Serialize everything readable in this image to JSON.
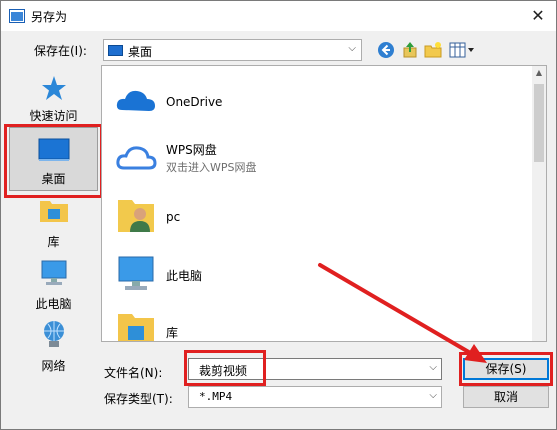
{
  "window": {
    "title": "另存为",
    "close_glyph": "✕"
  },
  "location": {
    "label": "保存在(I):",
    "value": "桌面"
  },
  "places": [
    {
      "label": "快速访问",
      "icon": "star-icon"
    },
    {
      "label": "桌面",
      "icon": "desktop-icon"
    },
    {
      "label": "库",
      "icon": "library-icon"
    },
    {
      "label": "此电脑",
      "icon": "computer-icon"
    },
    {
      "label": "网络",
      "icon": "network-icon"
    }
  ],
  "items": [
    {
      "name": "OneDrive",
      "sub": "",
      "icon": "onedrive-icon"
    },
    {
      "name": "WPS网盘",
      "sub": "双击进入WPS网盘",
      "icon": "wps-cloud-icon"
    },
    {
      "name": "pc",
      "sub": "",
      "icon": "user-folder-icon"
    },
    {
      "name": "此电脑",
      "sub": "",
      "icon": "computer-icon"
    },
    {
      "name": "库",
      "sub": "",
      "icon": "library-folder-icon"
    }
  ],
  "filename": {
    "label": "文件名(N):",
    "value": "裁剪视频"
  },
  "filetype": {
    "label": "保存类型(T):",
    "value": "*.MP4"
  },
  "buttons": {
    "save": "保存(S)",
    "cancel": "取消"
  },
  "colors": {
    "annotation_red": "#e02020",
    "accent": "#0078d7"
  }
}
